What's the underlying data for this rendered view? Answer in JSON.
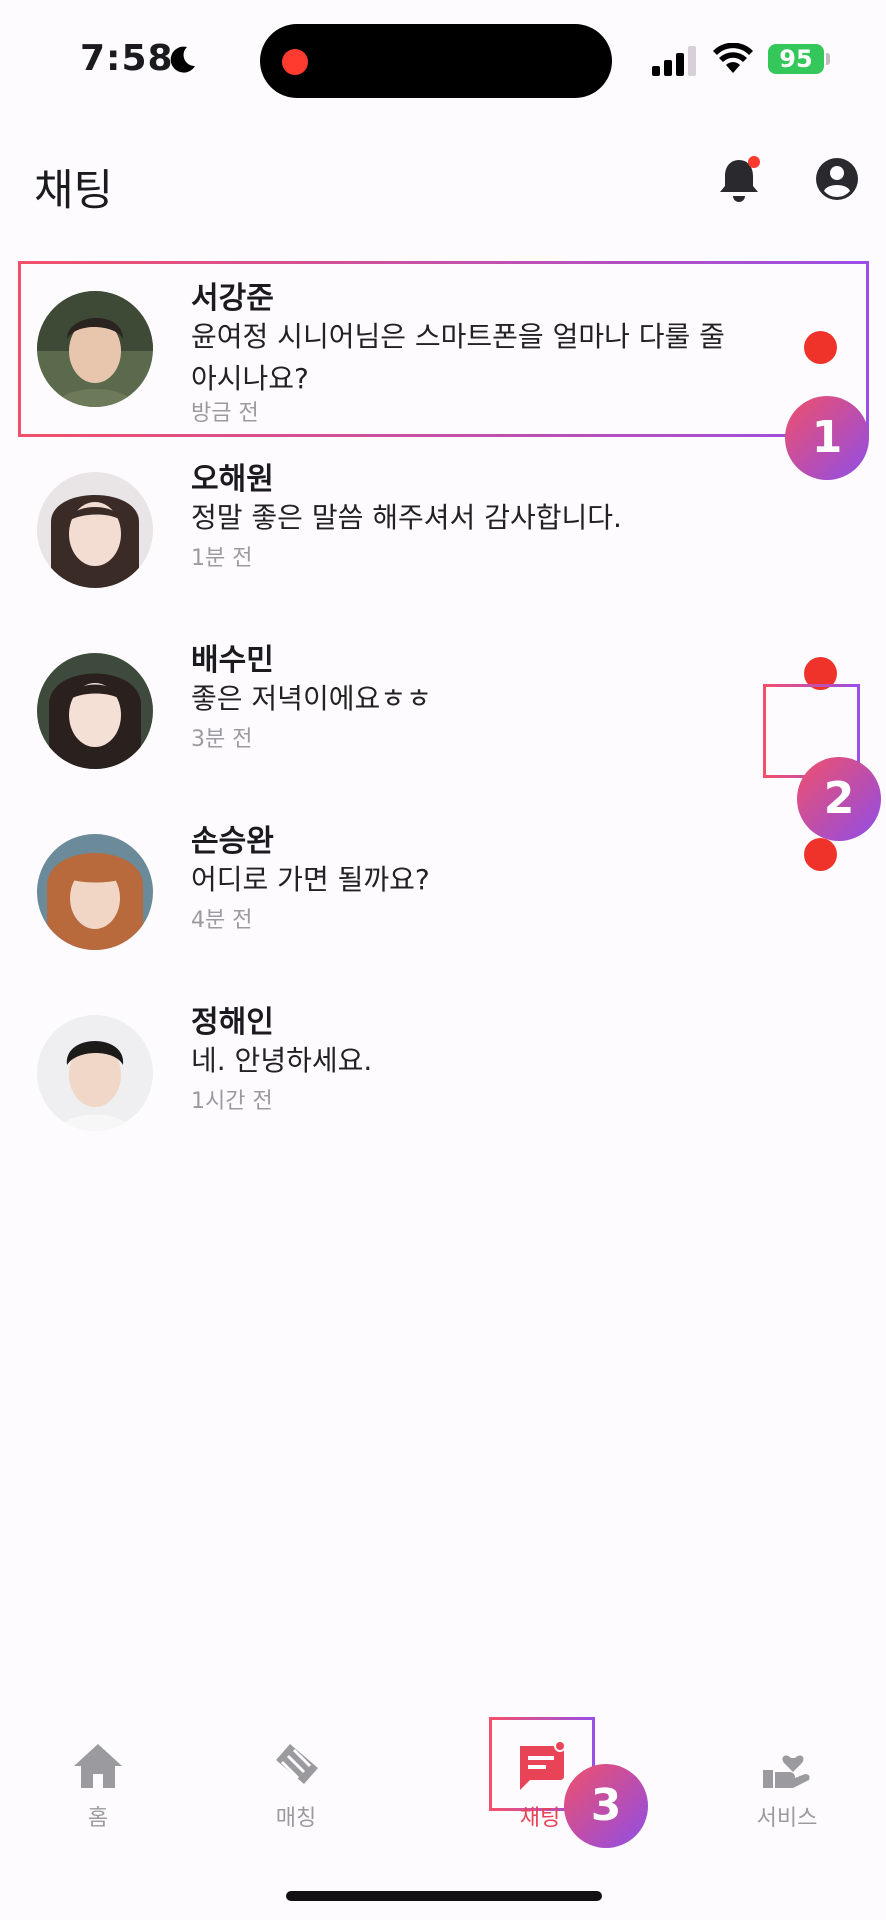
{
  "status_bar": {
    "time": "7:58",
    "battery": "95",
    "battery_color": "#34c759"
  },
  "header": {
    "title": "채팅",
    "bell_icon": "bell-icon",
    "profile_icon": "profile-icon",
    "notification_dot_color": "#ff3b30"
  },
  "chats": [
    {
      "name": "서강준",
      "message": "윤여정 시니어님은 스마트폰을 얼마나 다룰 줄 아시나요?",
      "time": "방금 전",
      "unread": true
    },
    {
      "name": "오해원",
      "message": "정말 좋은 말씀 해주셔서 감사합니다.",
      "time": "1분 전",
      "unread": false
    },
    {
      "name": "배수민",
      "message": "좋은 저녁이에요ㅎㅎ",
      "time": "3분 전",
      "unread": true
    },
    {
      "name": "손승완",
      "message": "어디로 가면 될까요?",
      "time": "4분 전",
      "unread": true
    },
    {
      "name": "정해인",
      "message": "네. 안녕하세요.",
      "time": "1시간 전",
      "unread": false
    }
  ],
  "annotations": [
    "1",
    "2",
    "3"
  ],
  "tabs": [
    {
      "label": "홈",
      "icon": "home-icon",
      "active": false
    },
    {
      "label": "매칭",
      "icon": "handshake-icon",
      "active": false
    },
    {
      "label": "채팅",
      "icon": "chat-icon",
      "active": true
    },
    {
      "label": "서비스",
      "icon": "service-hand-heart-icon",
      "active": false
    }
  ],
  "colors": {
    "unread_dot": "#f0332a",
    "active_tab": "#e84356",
    "inactive_tab": "#9b9b9f",
    "annotation_gradient_start": "#f0506a",
    "annotation_gradient_end": "#8f4de8"
  }
}
